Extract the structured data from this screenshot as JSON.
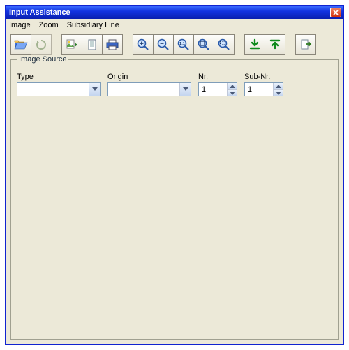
{
  "window": {
    "title": "Input Assistance"
  },
  "menu": {
    "image": "Image",
    "zoom": "Zoom",
    "subsidiary_line": "Subsidiary Line"
  },
  "toolbar": {
    "open_icon": "open-folder-icon",
    "refresh_icon": "refresh-icon",
    "page_in_icon": "image-to-page-icon",
    "page_icon": "page-icon",
    "print_icon": "print-icon",
    "zoom_in_icon": "zoom-in-icon",
    "zoom_out_icon": "zoom-out-icon",
    "zoom_100_icon": "zoom-100-icon",
    "zoom_fit_icon": "zoom-fit-icon",
    "zoom_sel_icon": "zoom-selection-icon",
    "down_green_icon": "download-icon",
    "up_green_icon": "upload-icon",
    "export_icon": "export-page-icon"
  },
  "image_source": {
    "legend": "Image Source",
    "labels": {
      "type": "Type",
      "origin": "Origin",
      "nr": "Nr.",
      "sub_nr": "Sub-Nr."
    },
    "values": {
      "type": "",
      "origin": "",
      "nr": "1",
      "sub_nr": "1"
    }
  }
}
